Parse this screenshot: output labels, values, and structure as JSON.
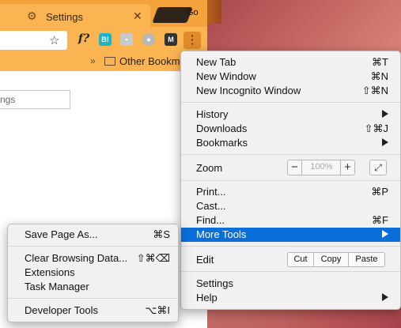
{
  "browser": {
    "tab_title": "Settings",
    "tab_icon": "gear-icon",
    "partial_tab_text": "Go",
    "bookmarks_overflow": "»",
    "bookmark_folder": "Other Bookm",
    "search_placeholder": "ngs",
    "extensions": {
      "f": "f?",
      "b": "B!",
      "m": "M"
    }
  },
  "main_menu": {
    "new_tab": {
      "label": "New Tab",
      "shortcut": "⌘T"
    },
    "new_window": {
      "label": "New Window",
      "shortcut": "⌘N"
    },
    "incognito": {
      "label": "New Incognito Window",
      "shortcut": "⇧⌘N"
    },
    "history": {
      "label": "History"
    },
    "downloads": {
      "label": "Downloads",
      "shortcut": "⇧⌘J"
    },
    "bookmarks": {
      "label": "Bookmarks"
    },
    "zoom": {
      "label": "Zoom",
      "minus": "−",
      "value": "100%",
      "plus": "+"
    },
    "print": {
      "label": "Print...",
      "shortcut": "⌘P"
    },
    "cast": {
      "label": "Cast..."
    },
    "find": {
      "label": "Find...",
      "shortcut": "⌘F"
    },
    "more_tools": {
      "label": "More Tools"
    },
    "edit": {
      "label": "Edit",
      "cut": "Cut",
      "copy": "Copy",
      "paste": "Paste"
    },
    "settings": {
      "label": "Settings"
    },
    "help": {
      "label": "Help"
    }
  },
  "more_tools_menu": {
    "save_page": {
      "label": "Save Page As...",
      "shortcut": "⌘S"
    },
    "clear_browsing": {
      "label": "Clear Browsing Data...",
      "shortcut": "⇧⌘⌫"
    },
    "extensions": {
      "label": "Extensions"
    },
    "task_manager": {
      "label": "Task Manager"
    },
    "developer_tools": {
      "label": "Developer Tools",
      "shortcut": "⌥⌘I"
    }
  },
  "colors": {
    "highlight": "#0a6fd8",
    "chrome_orange": "#fbb452"
  }
}
